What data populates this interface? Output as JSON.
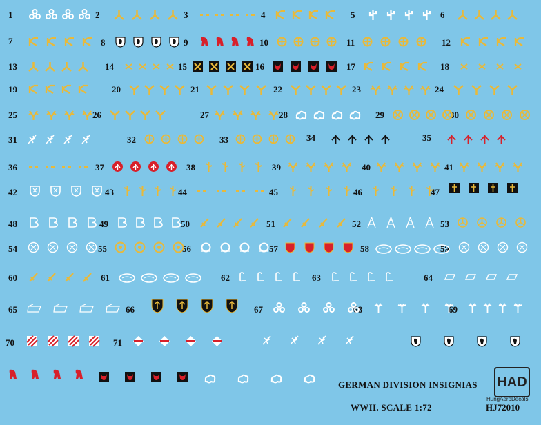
{
  "sheet": {
    "title": "GERMAN DIVISION INSIGNIAS",
    "subtitle": "WWII.   SCALE 1:72",
    "product_code": "HJ72010",
    "brand_logo": "HAD",
    "brand_name": "HungAeroDecals",
    "background_color": "#7fc6e8"
  },
  "insignia_numbers": [
    "1",
    "2",
    "3",
    "4",
    "5",
    "6",
    "7",
    "8",
    "9",
    "10",
    "11",
    "12",
    "13",
    "14",
    "15",
    "16",
    "17",
    "18",
    "19",
    "20",
    "21",
    "22",
    "23",
    "24",
    "25",
    "26",
    "27",
    "28",
    "29",
    "30",
    "31",
    "32",
    "33",
    "34",
    "35",
    "36",
    "37",
    "38",
    "39",
    "40",
    "41",
    "42",
    "43",
    "44",
    "45",
    "46",
    "47",
    "48",
    "49",
    "50",
    "51",
    "52",
    "53",
    "54",
    "55",
    "56",
    "57",
    "58",
    "59",
    "60",
    "61",
    "62",
    "63",
    "64",
    "65",
    "66",
    "67",
    "68",
    "69",
    "70",
    "71"
  ],
  "colors": {
    "white": "#ffffff",
    "yellow": "#e8b93a",
    "black": "#111111",
    "red": "#d8202a",
    "label": "#111111"
  },
  "decal_icons": {
    "trefoil-key": "white",
    "tripod": "yellow",
    "dash-marks": "yellow",
    "rune": "yellow",
    "cactus": "white",
    "bear-shield": "white",
    "bear-red": "red",
    "cross-wheel": "yellow",
    "devil-shield": "red",
    "stag-horn": "yellow",
    "cross": "yellow",
    "x-mark": "yellow",
    "x-box": "yellow",
    "y-rune": "yellow",
    "cloud-outline": "white",
    "crossed-circle": "yellow",
    "witch-broom": "white",
    "cross-circle-yellow": "yellow",
    "arrow-up": "black",
    "arrow-up-red": "red",
    "red-disc": "red",
    "thorn": "yellow",
    "leaf-shield": "white",
    "key": "white",
    "horseshoe": "white",
    "b-outline": "white",
    "sword": "yellow",
    "eiffel-tower": "white",
    "wheel-swirl": "yellow",
    "spiral-circle": "white",
    "sun-circle": "yellow",
    "red-shield": "red",
    "ring-banner": "white",
    "oval-plaque": "white",
    "gothic-l": "white",
    "parallelogram": "white",
    "flag-ea": "white",
    "black-shield": "black",
    "palm-tree": "white",
    "diamond-square": "red",
    "diamond-stripe": "red",
    "black-box": "black"
  }
}
